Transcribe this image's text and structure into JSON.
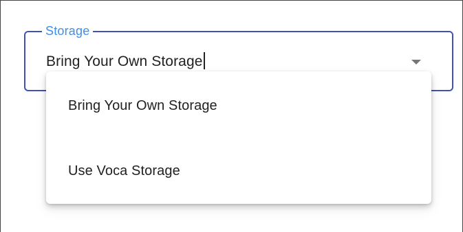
{
  "storage_field": {
    "label": "Storage",
    "value": "Bring Your Own Storage",
    "dropdown_icon": "chevron-down-icon",
    "accent_color": "#3f51b5",
    "label_color": "#3d8fe8"
  },
  "storage_menu": {
    "options": [
      {
        "label": "Bring Your Own Storage"
      },
      {
        "label": "Use Voca Storage"
      }
    ]
  }
}
